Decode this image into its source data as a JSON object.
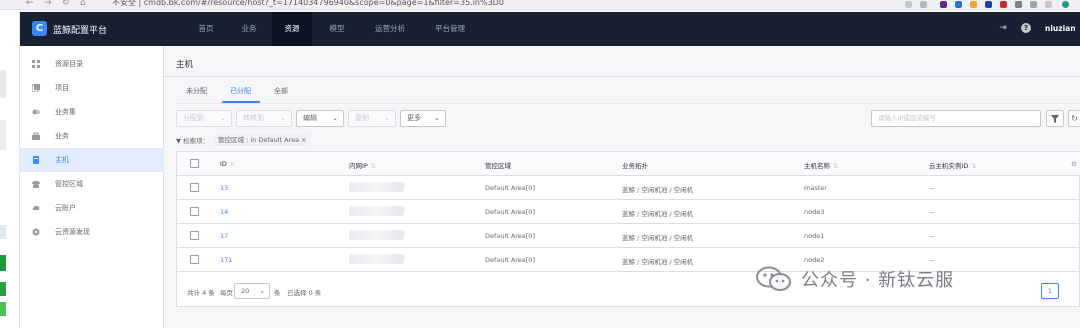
{
  "browser": {
    "url": "不安全 | cmdb.bk.com/#/resource/host?_t=1714034796940&scope=0&page=1&filter=35.in%3D0"
  },
  "app": {
    "brand": "蓝鲸配置平台",
    "logo_letter": "C"
  },
  "topnav": {
    "items": [
      "首页",
      "业务",
      "资源",
      "模型",
      "运营分析",
      "平台管理"
    ],
    "active": "资源",
    "user": "niuzian ⌄"
  },
  "sidebar": {
    "items": [
      {
        "label": "资源目录",
        "icon": "grid-icon"
      },
      {
        "label": "项目",
        "icon": "project-icon"
      },
      {
        "label": "业务集",
        "icon": "business-set-icon"
      },
      {
        "label": "业务",
        "icon": "business-icon"
      },
      {
        "label": "主机",
        "icon": "host-icon",
        "active": true
      },
      {
        "label": "管控区域",
        "icon": "cloud-area-icon"
      },
      {
        "label": "云账户",
        "icon": "cloud-account-icon"
      },
      {
        "label": "云资源发现",
        "icon": "cloud-discovery-icon"
      }
    ]
  },
  "main": {
    "title": "主机",
    "tabs": [
      "未分配",
      "已分配",
      "全部"
    ],
    "active_tab": "已分配",
    "toolbar": {
      "assign_to": "分配到",
      "transfer_to": "转移到",
      "edit": "编辑",
      "copy": "复制",
      "more": "更多"
    },
    "search_placeholder": "请输入IP或固资编号",
    "filter": {
      "label": "检索项：",
      "tag": "管控区域 : in Default Area"
    }
  },
  "table": {
    "columns": [
      "ID",
      "内网IP",
      "管控区域",
      "业务拓扑",
      "主机名称",
      "云主机实例ID"
    ],
    "rows": [
      {
        "id": "13",
        "area": "Default Area[0]",
        "topo": "蓝鲸 / 空闲机池 / 空闲机",
        "hostname": "master",
        "cloud_id": "--"
      },
      {
        "id": "14",
        "area": "Default Area[0]",
        "topo": "蓝鲸 / 空闲机池 / 空闲机",
        "hostname": "node3",
        "cloud_id": "--"
      },
      {
        "id": "17",
        "area": "Default Area[0]",
        "topo": "蓝鲸 / 空闲机池 / 空闲机",
        "hostname": "node1",
        "cloud_id": "--"
      },
      {
        "id": "171",
        "area": "Default Area[0]",
        "topo": "蓝鲸 / 空闲机池 / 空闲机",
        "hostname": "node2",
        "cloud_id": "--"
      }
    ],
    "pagination": {
      "total": "共计 4 条",
      "per_page_label": "每页",
      "per_page_value": "20",
      "unit": "条",
      "selected": "已选择 0 条",
      "current_page": "1"
    }
  },
  "watermark": {
    "text": "公众号 · 新钛云服"
  },
  "colors": {
    "primary": "#3a84ff",
    "nav_bg": "#182132",
    "active_bg": "#e1ecff"
  }
}
